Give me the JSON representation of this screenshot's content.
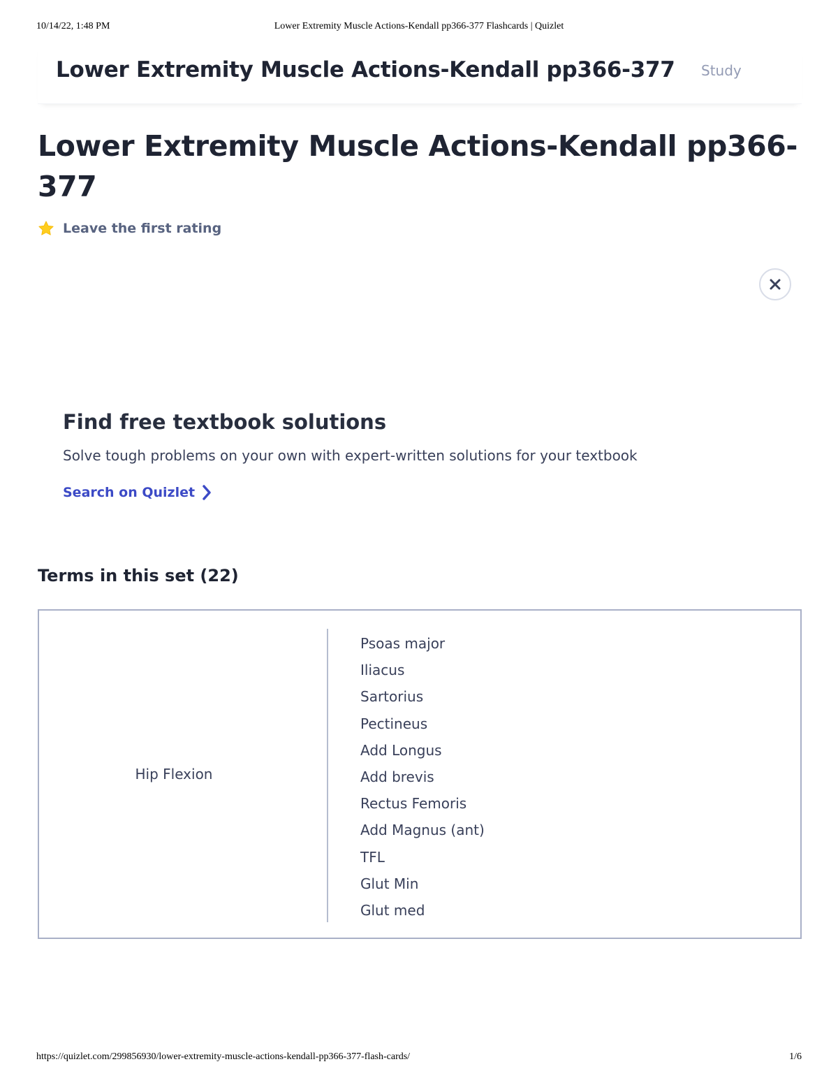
{
  "print_header": {
    "date": "10/14/22, 1:48 PM",
    "doc_title": "Lower Extremity Muscle Actions-Kendall pp366-377 Flashcards | Quizlet"
  },
  "topbar": {
    "set_title": "Lower Extremity Muscle Actions-Kendall pp366-377",
    "study_label": "Study"
  },
  "main": {
    "title": "Lower Extremity Muscle Actions-Kendall pp366-377",
    "rating_text": "Leave the first rating"
  },
  "promo": {
    "title": "Find free textbook solutions",
    "subtitle": "Solve tough problems on your own with expert-written solutions for your textbook",
    "link_label": "Search on Quizlet"
  },
  "terms": {
    "heading": "Terms in this set (22)",
    "cards": [
      {
        "term": "Hip Flexion",
        "definition": [
          "Psoas major",
          "Iliacus",
          "Sartorius",
          "Pectineus",
          "Add Longus",
          "Add brevis",
          "Rectus Femoris",
          "Add Magnus (ant)",
          "TFL",
          "Glut Min",
          "Glut med"
        ]
      }
    ]
  },
  "print_footer": {
    "url": "https://quizlet.com/299856930/lower-extremity-muscle-actions-kendall-pp366-377-flash-cards/",
    "page": "1/6"
  },
  "colors": {
    "accent_link": "#3c4ac6",
    "star": "#ffcd1f",
    "card_border": "#a9b0c7",
    "muted_text": "#939bb4"
  },
  "icons": {
    "rating": "star-icon",
    "close": "close-icon",
    "link_arrow": "chevron-right-icon"
  }
}
